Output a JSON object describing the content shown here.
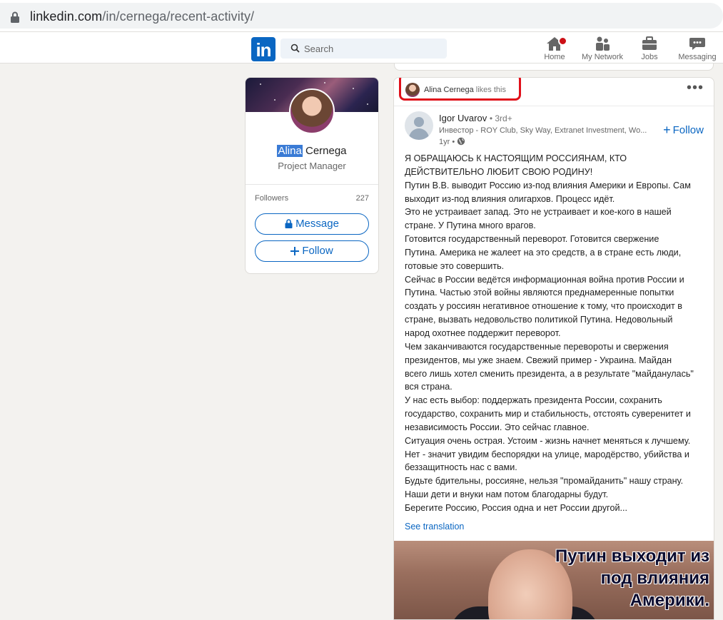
{
  "browser": {
    "url_domain": "linkedin.com",
    "url_path": "/in/cernega/recent-activity/"
  },
  "nav": {
    "logo": "in",
    "search_placeholder": "Search",
    "items": [
      {
        "label": "Home",
        "icon": "home-icon"
      },
      {
        "label": "My Network",
        "icon": "network-icon"
      },
      {
        "label": "Jobs",
        "icon": "briefcase-icon"
      },
      {
        "label": "Messaging",
        "icon": "messaging-icon"
      }
    ]
  },
  "profile": {
    "first_name": "Alina",
    "last_name": "Cernega",
    "title": "Project Manager",
    "followers_label": "Followers",
    "followers_count": "227",
    "message_label": "Message",
    "follow_label": "Follow"
  },
  "activity": {
    "liker_name": "Alina Cernega",
    "liker_action": "likes this",
    "author_name": "Igor Uvarov",
    "author_degree": "• 3rd+",
    "author_headline": "Инвестор - ROY Club, Sky Way, Extranet Investment, Wo...",
    "post_time": "1yr •",
    "follow_label": "Follow",
    "post_lines": [
      "Я ОБРАЩАЮСЬ К НАСТОЯЩИМ РОССИЯНАМ, КТО",
      "ДЕЙСТВИТЕЛЬНО ЛЮБИТ СВОЮ РОДИНУ!",
      "Путин В.В. выводит Россию из-под влияния Америки и Европы. Сам",
      "выходит из-под влияния олигархов. Процесс идёт.",
      "Это не устраивает запад. Это не устраивает и кое-кого в нашей",
      "стране. У Путина много врагов.",
      "Готовится государственный переворот. Готовится свержение",
      "Путина. Америка не жалеет на это средств, а в стране есть люди,",
      "готовые это совершить.",
      "Сейчас в России ведётся информационная война против России и",
      "Путина. Частью этой войны являются преднамеренные попытки",
      "создать у россиян негативное отношение к тому, что происходит в",
      "стране, вызвать недовольство политикой Путина. Недовольный",
      "народ охотнее поддержит переворот.",
      "Чем заканчиваются государственные перевороты и свержения",
      "президентов, мы уже знаем. Свежий пример - Украина. Майдан",
      "всего лишь хотел сменить президента, а в результате \"майданулась\"",
      "вся страна.",
      "У нас есть выбор: поддержать президента России, сохранить",
      "государство, сохранить мир и стабильность, отстоять суверенитет и",
      "независимость России. Это сейчас главное.",
      "Ситуация очень острая. Устоим - жизнь начнет меняться к лучшему.",
      "Нет - значит увидим беспорядки на улице, мародёрство, убийства и",
      "беззащитность нас с вами.",
      "Будьте бдительны, россияне, нельзя \"промайданить\" нашу страну.",
      "Наши дети и внуки нам потом благодарны будут.",
      "Берегите Россию, Россия одна и нет России другой..."
    ],
    "see_translation": "See translation",
    "image_caption": [
      "Путин выходит из",
      "под влияния",
      "Америки."
    ]
  },
  "colors": {
    "linkedin_blue": "#0a66c2",
    "highlight_box": "#e0101a",
    "background": "#f3f2ef"
  }
}
